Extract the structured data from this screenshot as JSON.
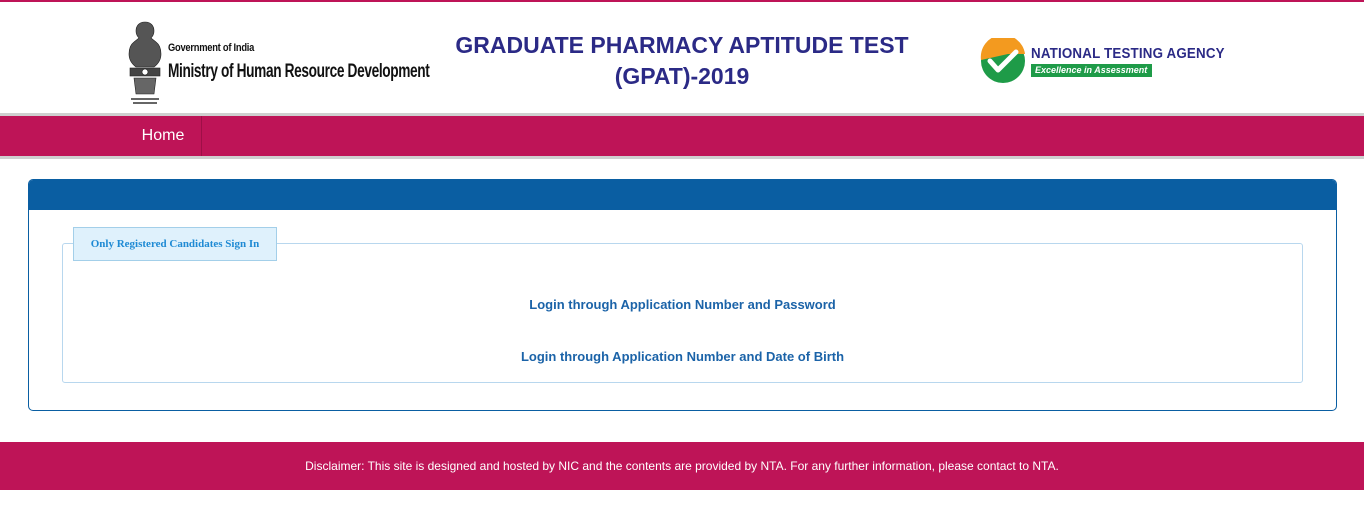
{
  "header": {
    "moe": {
      "gov_text": "Government of India",
      "ministry_text": "Ministry of Human Resource Development",
      "emblem_icon": "national-emblem-icon"
    },
    "title_line1": "GRADUATE PHARMACY APTITUDE TEST",
    "title_line2": "(GPAT)-2019",
    "nta": {
      "name": "NATIONAL TESTING AGENCY",
      "tagline": "Excellence in Assessment",
      "logo_icon": "nta-checkmark-logo-icon"
    }
  },
  "nav": {
    "items": [
      {
        "label": "Home"
      }
    ]
  },
  "login_panel": {
    "legend": "Only Registered Candidates Sign In",
    "links": [
      {
        "label": "Login through Application Number and Password"
      },
      {
        "label": "Login through Application Number and Date of Birth"
      }
    ]
  },
  "footer": {
    "disclaimer": "Disclaimer: This site is designed and hosted by NIC and the contents are provided by NTA. For any further information, please contact to NTA."
  },
  "colors": {
    "brand_magenta": "#be1457",
    "panel_blue": "#0a5ea2",
    "title_navy": "#2b2a86",
    "nta_green": "#1e9b48",
    "nta_orange": "#f39a1f"
  }
}
